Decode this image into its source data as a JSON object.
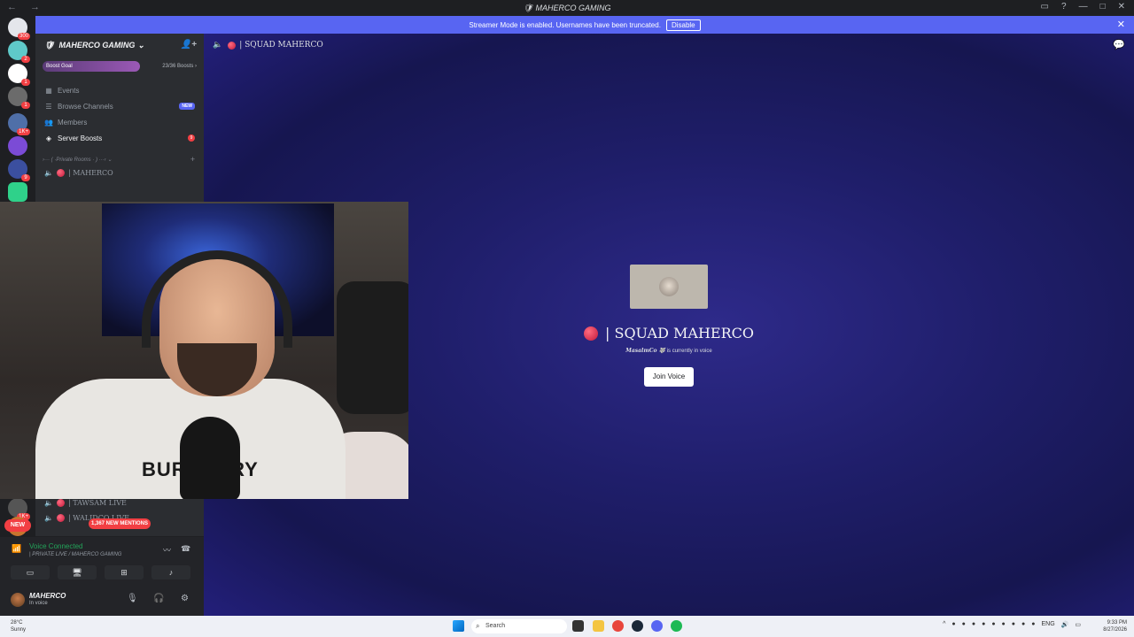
{
  "window": {
    "title": "MAHERCO GAMING",
    "nav_glyphs": "← →",
    "controls": [
      "▭",
      "?",
      "—",
      "□",
      "✕"
    ]
  },
  "streamer_bar": {
    "message": "Streamer Mode is enabled. Usernames have been truncated.",
    "disable_label": "Disable",
    "close_glyph": "✕"
  },
  "guilds": {
    "items": [
      {
        "badge": "300",
        "color": "#e4e6eb"
      },
      {
        "badge": "2",
        "color": "#5fc9c9"
      },
      {
        "badge": "1",
        "color": "#ffffff"
      },
      {
        "badge": "1",
        "color": "#6b6b6b"
      },
      {
        "badge": "1K+",
        "color": "#4f6fa8"
      },
      {
        "badge": "",
        "color": "#7b4bd6"
      },
      {
        "badge": "9",
        "color": "#3b4f9f"
      },
      {
        "badge": "",
        "color": "#2fd18a"
      }
    ],
    "bottom_badge": "1K+",
    "new_label": "NEW"
  },
  "server": {
    "name": "MAHERCO GAMING",
    "chevron": "⌄",
    "boost_goal_label": "Boost Goal",
    "boost_count": "23/36 Boosts ›",
    "menu": [
      {
        "label": "Events",
        "icon": "▦"
      },
      {
        "label": "Browse Channels",
        "icon": "☰",
        "tag": "NEW"
      },
      {
        "label": "Members",
        "icon": "👥"
      },
      {
        "label": "Server Boosts",
        "icon": "◈",
        "dot": "9"
      }
    ],
    "category": "›··· ( ·Private Rooms · ) ···‹ ⌄",
    "channels_top": [
      {
        "name": "| MAHERCO"
      }
    ],
    "channels_bottom": [
      {
        "name": "| TAWSAM LIVE"
      },
      {
        "name": "| WALIDCO LIVE"
      }
    ],
    "mentions_label": "1,367 NEW MENTIONS"
  },
  "voice_panel": {
    "status": "Voice Connected",
    "location": "| PRIVATE LIVE / MAHERCO GAMING",
    "user_name": "MAHERCO",
    "user_status": "In voice"
  },
  "main": {
    "channel_name": "| SQUAD MAHERCO",
    "big_title": "| SQUAD MAHERCO",
    "in_voice_user": "MasalmCo 🐺",
    "in_voice_text": "is currently in voice",
    "join_label": "Join Voice"
  },
  "webcam": {
    "shirt_text": "BURBERRY"
  },
  "taskbar": {
    "temp": "28°C",
    "weather": "Sunny",
    "search_placeholder": "Search",
    "lang": "ENG",
    "time": "9:33 PM",
    "date": "8/27/2026"
  }
}
